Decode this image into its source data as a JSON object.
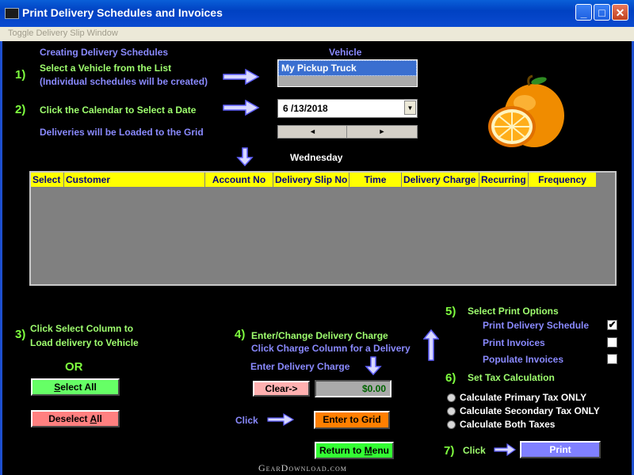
{
  "window": {
    "title": "Print Delivery Schedules and Invoices",
    "menu_item": "Toggle Delivery Slip Window",
    "minimize": "_",
    "maximize": "□",
    "close": "✕"
  },
  "steps": {
    "heading": "Creating Delivery Schedules",
    "step1_num": "1)",
    "step1_line1": "Select a Vehicle from the List",
    "step1_line2": "(Individual schedules will be created)",
    "step2_num": "2)",
    "step2_text": "Click the Calendar to Select a Date",
    "loaded_text": "Deliveries will be Loaded to the Grid",
    "step3_num": "3)",
    "step3_line1": "Click Select Column to",
    "step3_line2": "Load delivery to Vehicle",
    "or_text": "OR",
    "step4_num": "4)",
    "step4_line1": "Enter/Change Delivery Charge",
    "step4_line2": "Click Charge Column for a Delivery",
    "enter_charge_label": "Enter Delivery Charge",
    "click_label": "Click",
    "step5_num": "5)",
    "step5_text": "Select Print Options",
    "step6_num": "6)",
    "step6_text": "Set Tax Calculation",
    "step7_num": "7)",
    "step7_text": "Click"
  },
  "vehicle": {
    "label": "Vehicle",
    "selected": "My Pickup Truck"
  },
  "date": {
    "value": "6 /13/2018",
    "weekday": "Wednesday",
    "scroll_left": "◄",
    "scroll_right": "►",
    "dropdown": "▼"
  },
  "grid": {
    "columns": [
      "Select",
      "Customer",
      "Account No",
      "Delivery Slip No",
      "Time",
      "Delivery Charge",
      "Recurring",
      "Frequency"
    ],
    "rows": []
  },
  "buttons": {
    "select_all_pre": "",
    "select_all_u": "S",
    "select_all_post": "elect All",
    "deselect_all_pre": "Deselect ",
    "deselect_all_u": "A",
    "deselect_all_post": "ll",
    "clear": "Clear->",
    "enter_to_grid": "Enter to Grid",
    "return_pre": "Return to ",
    "return_u": "M",
    "return_post": "enu",
    "print": "Print"
  },
  "charge": {
    "value": "$0.00"
  },
  "print_options": [
    {
      "label": "Print Delivery Schedule",
      "checked": true
    },
    {
      "label": "Print Invoices",
      "checked": false
    },
    {
      "label": "Populate Invoices",
      "checked": false
    }
  ],
  "tax_options": [
    {
      "label": "Calculate Primary Tax ONLY"
    },
    {
      "label": "Calculate Secondary Tax ONLY"
    },
    {
      "label": "Calculate Both Taxes"
    }
  ],
  "watermark": "GearDownload.com",
  "checkmark": "✔",
  "colors": {
    "title_bar": "#0041c2",
    "grid_header": "#ffff00",
    "select_all": "#66ff66",
    "deselect_all": "#ff8080",
    "clear": "#ffb0b0",
    "enter_to_grid": "#ff7f00",
    "return_to_menu": "#33ff33",
    "print": "#8080ff"
  }
}
